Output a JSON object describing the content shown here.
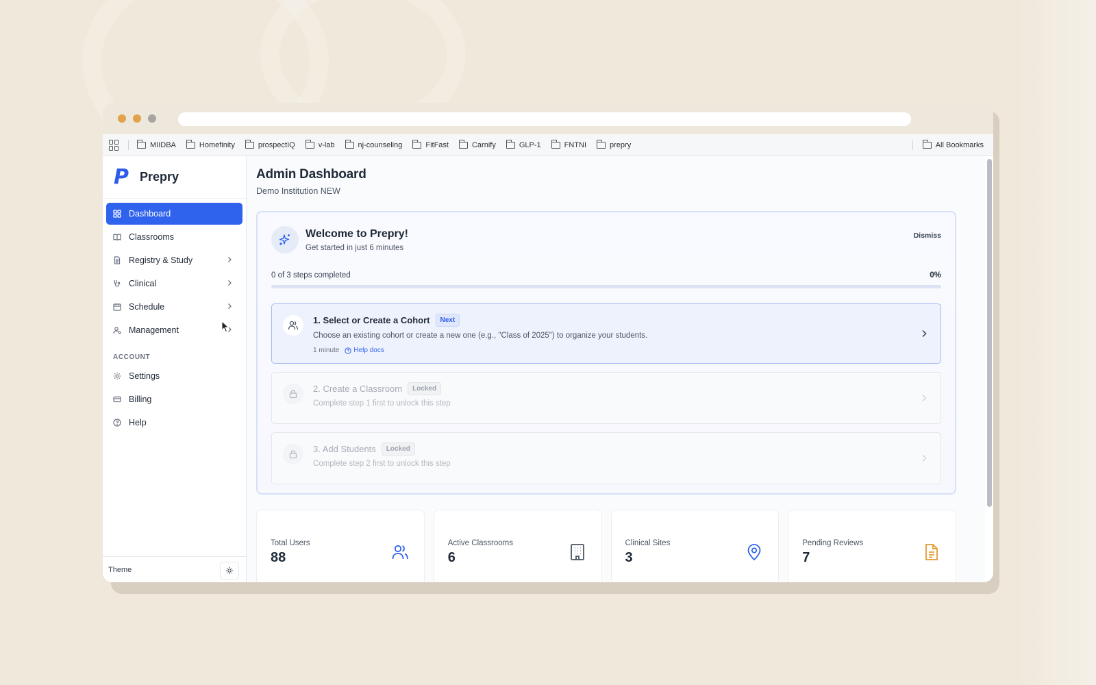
{
  "browser": {
    "bookmarks": [
      "MIIDBA",
      "Homefinity",
      "prospectIQ",
      "v-lab",
      "nj-counseling",
      "FitFast",
      "Carnify",
      "GLP-1",
      "FNTNI",
      "prepry"
    ],
    "all_bookmarks": "All Bookmarks"
  },
  "sidebar": {
    "brand_logo": "P",
    "brand_name": "Prepry",
    "nav": [
      {
        "label": "Dashboard",
        "icon": "dashboard-icon",
        "active": true
      },
      {
        "label": "Classrooms",
        "icon": "book-icon"
      },
      {
        "label": "Registry & Study",
        "icon": "document-icon",
        "has_submenu": true
      },
      {
        "label": "Clinical",
        "icon": "stethoscope-icon",
        "has_submenu": true
      },
      {
        "label": "Schedule",
        "icon": "calendar-icon",
        "has_submenu": true
      },
      {
        "label": "Management",
        "icon": "users-cog-icon",
        "has_submenu": true
      }
    ],
    "account_section": "ACCOUNT",
    "account": [
      {
        "label": "Settings",
        "icon": "gear-icon"
      },
      {
        "label": "Billing",
        "icon": "credit-card-icon"
      },
      {
        "label": "Help",
        "icon": "help-circle-icon"
      }
    ],
    "theme_label": "Theme"
  },
  "header": {
    "title": "Admin Dashboard",
    "subtitle": "Demo Institution NEW"
  },
  "welcome": {
    "title": "Welcome to Prepry!",
    "subtitle": "Get started in just 6 minutes",
    "dismiss": "Dismiss",
    "progress_text": "0 of 3 steps completed",
    "progress_pct_label": "0%",
    "progress_value": 0,
    "steps": [
      {
        "title": "1. Select or Create a Cohort",
        "badge": "Next",
        "desc": "Choose an existing cohort or create a new one (e.g., \"Class of 2025\") to organize your students.",
        "time": "1 minute",
        "help": "Help docs"
      },
      {
        "title": "2. Create a Classroom",
        "badge": "Locked",
        "desc": "Complete step 1 first to unlock this step"
      },
      {
        "title": "3. Add Students",
        "badge": "Locked",
        "desc": "Complete step 2 first to unlock this step"
      }
    ]
  },
  "stats": [
    {
      "label": "Total Users",
      "value": "88",
      "icon": "users-icon",
      "color": "#2f63ee"
    },
    {
      "label": "Active Classrooms",
      "value": "6",
      "icon": "building-icon",
      "color": "#4b5563"
    },
    {
      "label": "Clinical Sites",
      "value": "3",
      "icon": "map-pin-icon",
      "color": "#2f63ee"
    },
    {
      "label": "Pending Reviews",
      "value": "7",
      "icon": "file-text-icon",
      "color": "#e29a2e"
    }
  ],
  "colors": {
    "accent": "#2f63ee",
    "background": "#efe8db"
  }
}
